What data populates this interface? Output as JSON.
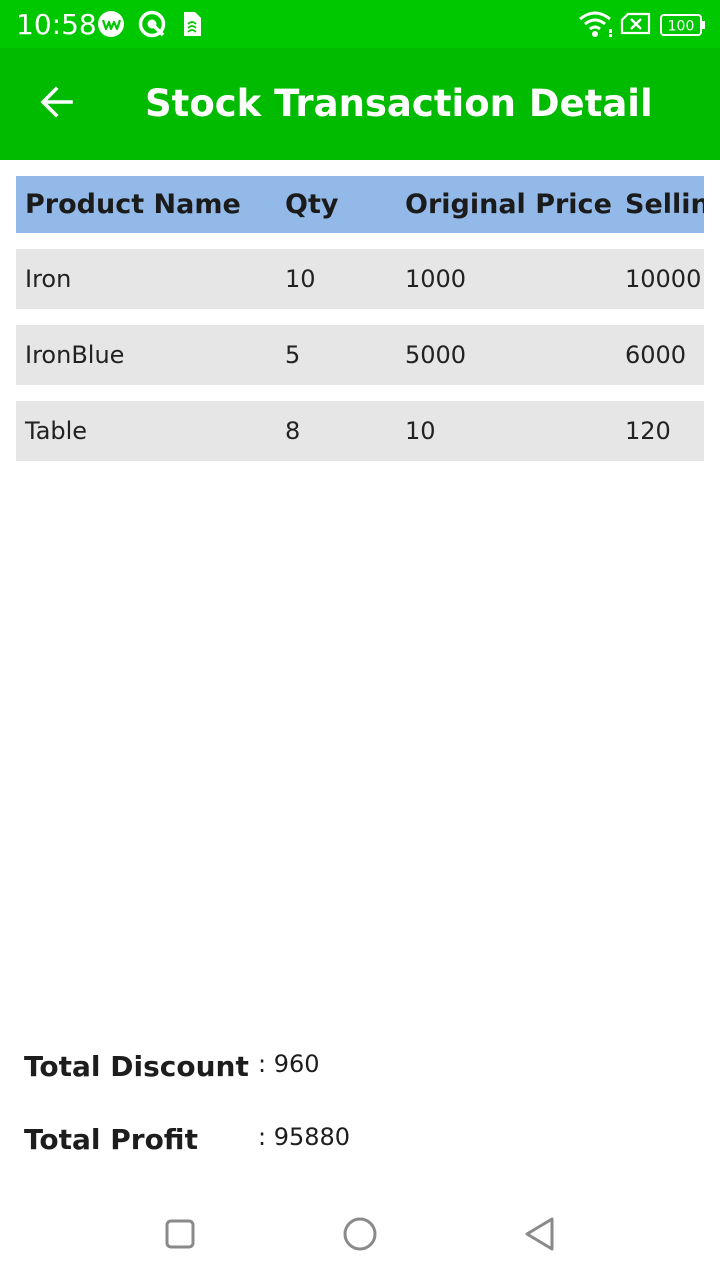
{
  "status_bar": {
    "time": "10:58",
    "battery": "100",
    "icons": [
      "wechat-work-icon",
      "circle-app-icon",
      "sim-card-icon",
      "wifi-icon",
      "no-sim-icon",
      "battery-icon"
    ]
  },
  "app_bar": {
    "title": "Stock Transaction Detail",
    "back_icon": "arrow-left-icon"
  },
  "table": {
    "columns": [
      "Product Name",
      "Qty",
      "Original Price",
      "Selling"
    ],
    "rows": [
      {
        "product": "Iron",
        "qty": "10",
        "original_price": "1000",
        "selling": "10000"
      },
      {
        "product": "IronBlue",
        "qty": "5",
        "original_price": "5000",
        "selling": "6000"
      },
      {
        "product": "Table",
        "qty": "8",
        "original_price": "10",
        "selling": "120"
      }
    ]
  },
  "totals": {
    "discount_label": "Total Discount",
    "discount_value": ": 960",
    "profit_label": "Total Profit",
    "profit_value": ": 95880"
  },
  "nav_bar": {
    "icons": [
      "recents-square-icon",
      "home-circle-icon",
      "back-triangle-icon"
    ]
  },
  "colors": {
    "status_bar": "#00c800",
    "app_bar": "#00bb00",
    "header_row": "#92b9e8",
    "data_row": "#e6e6e6"
  }
}
